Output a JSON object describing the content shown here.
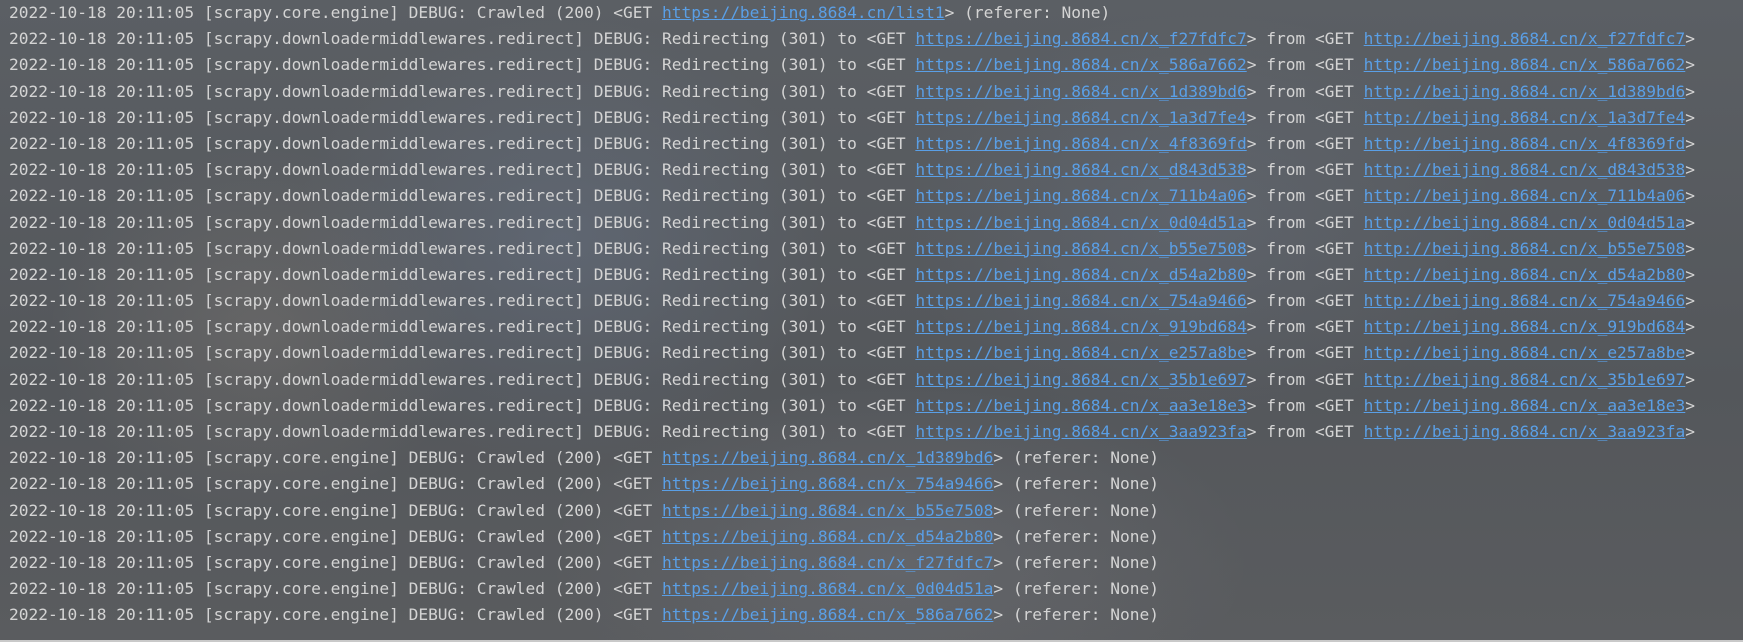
{
  "theme": {
    "text_color": "#d4d4d4",
    "link_color": "#5a9fe6",
    "background": "#55585b"
  },
  "console": {
    "lines": [
      {
        "text_before": "2022-10-18 20:11:05 [scrapy.core.engine] DEBUG: Crawled (200) <GET ",
        "link1": "https://beijing.8684.cn/list1",
        "middle": "> (referer: None)",
        "link2": "",
        "text_after": ""
      },
      {
        "text_before": "2022-10-18 20:11:05 [scrapy.downloadermiddlewares.redirect] DEBUG: Redirecting (301) to <GET ",
        "link1": "https://beijing.8684.cn/x_f27fdfc7",
        "middle": "> from <GET ",
        "link2": "http://beijing.8684.cn/x_f27fdfc7",
        "text_after": ">"
      },
      {
        "text_before": "2022-10-18 20:11:05 [scrapy.downloadermiddlewares.redirect] DEBUG: Redirecting (301) to <GET ",
        "link1": "https://beijing.8684.cn/x_586a7662",
        "middle": "> from <GET ",
        "link2": "http://beijing.8684.cn/x_586a7662",
        "text_after": ">"
      },
      {
        "text_before": "2022-10-18 20:11:05 [scrapy.downloadermiddlewares.redirect] DEBUG: Redirecting (301) to <GET ",
        "link1": "https://beijing.8684.cn/x_1d389bd6",
        "middle": "> from <GET ",
        "link2": "http://beijing.8684.cn/x_1d389bd6",
        "text_after": ">"
      },
      {
        "text_before": "2022-10-18 20:11:05 [scrapy.downloadermiddlewares.redirect] DEBUG: Redirecting (301) to <GET ",
        "link1": "https://beijing.8684.cn/x_1a3d7fe4",
        "middle": "> from <GET ",
        "link2": "http://beijing.8684.cn/x_1a3d7fe4",
        "text_after": ">"
      },
      {
        "text_before": "2022-10-18 20:11:05 [scrapy.downloadermiddlewares.redirect] DEBUG: Redirecting (301) to <GET ",
        "link1": "https://beijing.8684.cn/x_4f8369fd",
        "middle": "> from <GET ",
        "link2": "http://beijing.8684.cn/x_4f8369fd",
        "text_after": ">"
      },
      {
        "text_before": "2022-10-18 20:11:05 [scrapy.downloadermiddlewares.redirect] DEBUG: Redirecting (301) to <GET ",
        "link1": "https://beijing.8684.cn/x_d843d538",
        "middle": "> from <GET ",
        "link2": "http://beijing.8684.cn/x_d843d538",
        "text_after": ">"
      },
      {
        "text_before": "2022-10-18 20:11:05 [scrapy.downloadermiddlewares.redirect] DEBUG: Redirecting (301) to <GET ",
        "link1": "https://beijing.8684.cn/x_711b4a06",
        "middle": "> from <GET ",
        "link2": "http://beijing.8684.cn/x_711b4a06",
        "text_after": ">"
      },
      {
        "text_before": "2022-10-18 20:11:05 [scrapy.downloadermiddlewares.redirect] DEBUG: Redirecting (301) to <GET ",
        "link1": "https://beijing.8684.cn/x_0d04d51a",
        "middle": "> from <GET ",
        "link2": "http://beijing.8684.cn/x_0d04d51a",
        "text_after": ">"
      },
      {
        "text_before": "2022-10-18 20:11:05 [scrapy.downloadermiddlewares.redirect] DEBUG: Redirecting (301) to <GET ",
        "link1": "https://beijing.8684.cn/x_b55e7508",
        "middle": "> from <GET ",
        "link2": "http://beijing.8684.cn/x_b55e7508",
        "text_after": ">"
      },
      {
        "text_before": "2022-10-18 20:11:05 [scrapy.downloadermiddlewares.redirect] DEBUG: Redirecting (301) to <GET ",
        "link1": "https://beijing.8684.cn/x_d54a2b80",
        "middle": "> from <GET ",
        "link2": "http://beijing.8684.cn/x_d54a2b80",
        "text_after": ">"
      },
      {
        "text_before": "2022-10-18 20:11:05 [scrapy.downloadermiddlewares.redirect] DEBUG: Redirecting (301) to <GET ",
        "link1": "https://beijing.8684.cn/x_754a9466",
        "middle": "> from <GET ",
        "link2": "http://beijing.8684.cn/x_754a9466",
        "text_after": ">"
      },
      {
        "text_before": "2022-10-18 20:11:05 [scrapy.downloadermiddlewares.redirect] DEBUG: Redirecting (301) to <GET ",
        "link1": "https://beijing.8684.cn/x_919bd684",
        "middle": "> from <GET ",
        "link2": "http://beijing.8684.cn/x_919bd684",
        "text_after": ">"
      },
      {
        "text_before": "2022-10-18 20:11:05 [scrapy.downloadermiddlewares.redirect] DEBUG: Redirecting (301) to <GET ",
        "link1": "https://beijing.8684.cn/x_e257a8be",
        "middle": "> from <GET ",
        "link2": "http://beijing.8684.cn/x_e257a8be",
        "text_after": ">"
      },
      {
        "text_before": "2022-10-18 20:11:05 [scrapy.downloadermiddlewares.redirect] DEBUG: Redirecting (301) to <GET ",
        "link1": "https://beijing.8684.cn/x_35b1e697",
        "middle": "> from <GET ",
        "link2": "http://beijing.8684.cn/x_35b1e697",
        "text_after": ">"
      },
      {
        "text_before": "2022-10-18 20:11:05 [scrapy.downloadermiddlewares.redirect] DEBUG: Redirecting (301) to <GET ",
        "link1": "https://beijing.8684.cn/x_aa3e18e3",
        "middle": "> from <GET ",
        "link2": "http://beijing.8684.cn/x_aa3e18e3",
        "text_after": ">"
      },
      {
        "text_before": "2022-10-18 20:11:05 [scrapy.downloadermiddlewares.redirect] DEBUG: Redirecting (301) to <GET ",
        "link1": "https://beijing.8684.cn/x_3aa923fa",
        "middle": "> from <GET ",
        "link2": "http://beijing.8684.cn/x_3aa923fa",
        "text_after": ">"
      },
      {
        "text_before": "2022-10-18 20:11:05 [scrapy.core.engine] DEBUG: Crawled (200) <GET ",
        "link1": "https://beijing.8684.cn/x_1d389bd6",
        "middle": "> (referer: None)",
        "link2": "",
        "text_after": ""
      },
      {
        "text_before": "2022-10-18 20:11:05 [scrapy.core.engine] DEBUG: Crawled (200) <GET ",
        "link1": "https://beijing.8684.cn/x_754a9466",
        "middle": "> (referer: None)",
        "link2": "",
        "text_after": ""
      },
      {
        "text_before": "2022-10-18 20:11:05 [scrapy.core.engine] DEBUG: Crawled (200) <GET ",
        "link1": "https://beijing.8684.cn/x_b55e7508",
        "middle": "> (referer: None)",
        "link2": "",
        "text_after": ""
      },
      {
        "text_before": "2022-10-18 20:11:05 [scrapy.core.engine] DEBUG: Crawled (200) <GET ",
        "link1": "https://beijing.8684.cn/x_d54a2b80",
        "middle": "> (referer: None)",
        "link2": "",
        "text_after": ""
      },
      {
        "text_before": "2022-10-18 20:11:05 [scrapy.core.engine] DEBUG: Crawled (200) <GET ",
        "link1": "https://beijing.8684.cn/x_f27fdfc7",
        "middle": "> (referer: None)",
        "link2": "",
        "text_after": ""
      },
      {
        "text_before": "2022-10-18 20:11:05 [scrapy.core.engine] DEBUG: Crawled (200) <GET ",
        "link1": "https://beijing.8684.cn/x_0d04d51a",
        "middle": "> (referer: None)",
        "link2": "",
        "text_after": ""
      },
      {
        "text_before": "2022-10-18 20:11:05 [scrapy.core.engine] DEBUG: Crawled (200) <GET ",
        "link1": "https://beijing.8684.cn/x_586a7662",
        "middle": "> (referer: None)",
        "link2": "",
        "text_after": ""
      }
    ]
  }
}
